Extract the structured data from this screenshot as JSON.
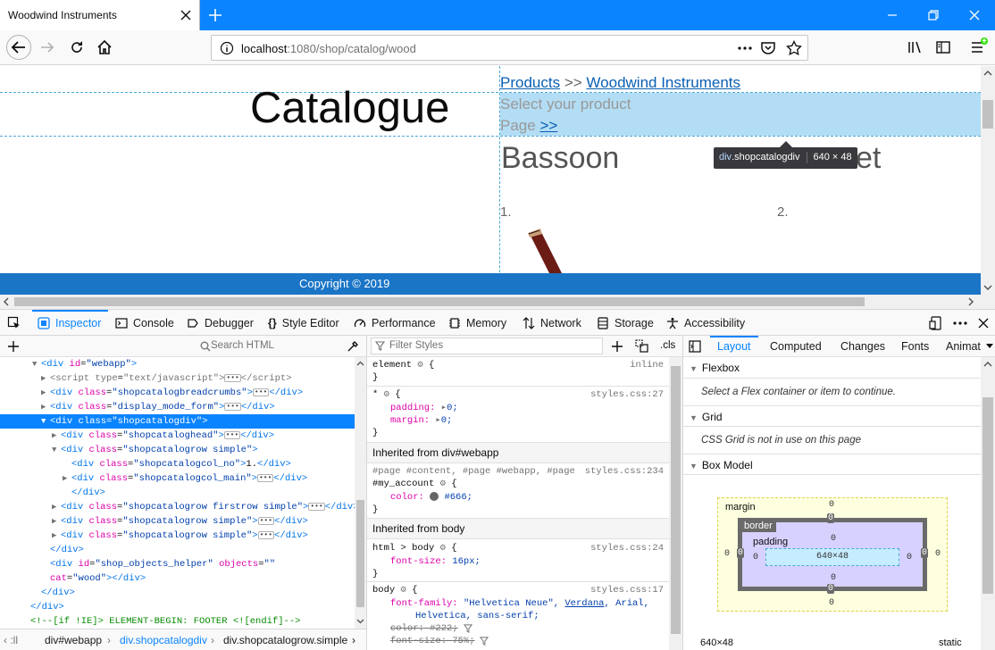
{
  "browser": {
    "tab_title": "Woodwind Instruments",
    "url_host": "localhost",
    "url_rest": ":1080/shop/catalog/wood"
  },
  "page": {
    "heading": "Catalogue",
    "breadcrumb_products": "Products",
    "breadcrumb_sep": ">>",
    "breadcrumb_current": "Woodwind Instruments",
    "select_product": "Select your product",
    "page_label": "Page",
    "page_next": ">>",
    "product_1_name": "Bassoon",
    "product_2_name_partial": "et",
    "item_1_number": "1.",
    "item_2_number": "2.",
    "footer": "Copyright © 2019",
    "tooltip_tag": "div",
    "tooltip_class": ".shopcatalogdiv",
    "tooltip_size": "640 × 48"
  },
  "devtools": {
    "tabs": [
      "Inspector",
      "Console",
      "Debugger",
      "Style Editor",
      "Performance",
      "Memory",
      "Network",
      "Storage",
      "Accessibility"
    ],
    "search_html_placeholder": "Search HTML",
    "filter_styles_placeholder": "Filter Styles",
    "cls_label": ".cls",
    "markup": [
      {
        "indent": 36,
        "twisty": "▼",
        "html": "<span class=\"t\">&lt;div</span> <span class=\"a\">id</span>=<span class=\"v\">\"webapp\"</span><span class=\"t\">&gt;</span>"
      },
      {
        "indent": 46,
        "twisty": "▶",
        "html": "<span class=\"c\">&lt;script</span> <span class=\"c\">type</span>=<span class=\"c\">\"text/javascript\"</span><span class=\"c\">&gt;</span><span class=\"ell\">•••</span><span class=\"c\">&lt;/script&gt;</span>"
      },
      {
        "indent": 46,
        "twisty": "▶",
        "html": "<span class=\"t\">&lt;div</span> <span class=\"a\">class</span>=<span class=\"v\">\"shopcatalogbreadcrumbs\"</span><span class=\"t\">&gt;</span><span class=\"ell\">•••</span><span class=\"t\">&lt;/div&gt;</span>"
      },
      {
        "indent": 46,
        "twisty": "▶",
        "html": "<span class=\"t\">&lt;div</span> <span class=\"a\">class</span>=<span class=\"v\">\"display_mode_form\"</span><span class=\"t\">&gt;</span><span class=\"ell\">•••</span><span class=\"t\">&lt;/div&gt;</span>"
      },
      {
        "indent": 46,
        "twisty": "▼",
        "html": "<span class=\"t\">&lt;div</span> <span class=\"a\">class</span>=<span class=\"v\">\"shopcatalogdiv\"</span><span class=\"t\">&gt;</span>",
        "selected": true
      },
      {
        "indent": 58,
        "twisty": "▶",
        "html": "<span class=\"t\">&lt;div</span> <span class=\"a\">class</span>=<span class=\"v\">\"shopcataloghead\"</span><span class=\"t\">&gt;</span><span class=\"ell\">•••</span><span class=\"t\">&lt;/div&gt;</span>"
      },
      {
        "indent": 58,
        "twisty": "▼",
        "html": "<span class=\"t\">&lt;div</span> <span class=\"a\">class</span>=<span class=\"v\">\"shopcatalogrow simple\"</span><span class=\"t\">&gt;</span>"
      },
      {
        "indent": 70,
        "twisty": "",
        "html": "<span class=\"t\">&lt;div</span> <span class=\"a\">class</span>=<span class=\"v\">\"shopcatalogcol_no\"</span><span class=\"t\">&gt;</span><span class=\"tx\">1.</span><span class=\"t\">&lt;/div&gt;</span>"
      },
      {
        "indent": 70,
        "twisty": "▶",
        "html": "<span class=\"t\">&lt;div</span> <span class=\"a\">class</span>=<span class=\"v\">\"shopcatalogcol_main\"</span><span class=\"t\">&gt;</span><span class=\"ell\">•••</span><span class=\"t\">&lt;/div&gt;</span>"
      },
      {
        "indent": 70,
        "twisty": "",
        "html": "<span class=\"t\">&lt;/div&gt;</span>"
      },
      {
        "indent": 58,
        "twisty": "▶",
        "html": "<span class=\"t\">&lt;div</span> <span class=\"a\">class</span>=<span class=\"v\">\"shopcatalogrow firstrow simple\"</span><span class=\"t\">&gt;</span><span class=\"ell\">•••</span><span class=\"t\">&lt;/div&gt;</span>"
      },
      {
        "indent": 58,
        "twisty": "▶",
        "html": "<span class=\"t\">&lt;div</span> <span class=\"a\">class</span>=<span class=\"v\">\"shopcatalogrow simple\"</span><span class=\"t\">&gt;</span><span class=\"ell\">•••</span><span class=\"t\">&lt;/div&gt;</span>"
      },
      {
        "indent": 58,
        "twisty": "▶",
        "html": "<span class=\"t\">&lt;div</span> <span class=\"a\">class</span>=<span class=\"v\">\"shopcatalogrow simple\"</span><span class=\"t\">&gt;</span><span class=\"ell\">•••</span><span class=\"t\">&lt;/div&gt;</span>"
      },
      {
        "indent": 46,
        "twisty": "",
        "html": "<span class=\"t\">&lt;/div&gt;</span>"
      },
      {
        "indent": 46,
        "twisty": "",
        "html": "<span class=\"t\">&lt;div</span> <span class=\"a\">id</span>=<span class=\"v\">\"shop_objects_helper\"</span> <span class=\"a\">objects</span>=<span class=\"v\">\"\"</span>"
      },
      {
        "indent": 46,
        "twisty": "",
        "html": "<span class=\"a\">cat</span>=<span class=\"v\">\"wood\"</span><span class=\"t\">&gt;&lt;/div&gt;</span>"
      },
      {
        "indent": 36,
        "twisty": "",
        "html": "<span class=\"t\">&lt;/div&gt;</span>"
      },
      {
        "indent": 24,
        "twisty": "",
        "html": "<span class=\"t\">&lt;/div&gt;</span>"
      },
      {
        "indent": 24,
        "twisty": "",
        "html": "<span style=\"color:#058b00\">&lt;!--[if !IE]&gt; ELEMENT-BEGIN: FOOTER &lt;![endif]--&gt;</span>"
      }
    ],
    "breadcrumbs": [
      "div#webapp",
      "div.shopcatalogdiv",
      "div.shopcatalogrow.simple"
    ],
    "rules": {
      "element_selector": "element",
      "element_source": "inline",
      "star_selector": "*",
      "star_source": "styles.css:27",
      "padding_prop": "padding:",
      "padding_val": "0;",
      "margin_prop": "margin:",
      "margin_val": "0;",
      "inherited_webapp": "Inherited from div#webapp",
      "webapp_selector_1": "#page #content, #page #webapp, #page",
      "webapp_selector_2": "#my_account",
      "webapp_source": "styles.css:234",
      "color_prop": "color:",
      "color_val": "#666;",
      "inherited_body": "Inherited from body",
      "html_body_selector": "html > body",
      "html_body_source": "styles.css:24",
      "fontsize_prop": "font-size:",
      "fontsize_val": "16px;",
      "body_selector": "body",
      "body_source": "styles.css:17",
      "fontfamily_prop": "font-family:",
      "fontfamily_val_1": "\"Helvetica Neue\",",
      "fontfamily_val_2": "Verdana",
      "fontfamily_val_3": ", Arial,",
      "fontfamily_val_4": "Helvetica, sans-serif;",
      "color2_prop": "color:",
      "color2_val": "#222;",
      "fontsize2_prop": "font-size:",
      "fontsize2_val": "75%;"
    },
    "layout_tabs": [
      "Layout",
      "Computed",
      "Changes",
      "Fonts",
      "Animat"
    ],
    "flexbox_title": "Flexbox",
    "flexbox_msg": "Select a Flex container or item to continue.",
    "grid_title": "Grid",
    "grid_msg": "CSS Grid is not in use on this page",
    "boxmodel_title": "Box Model",
    "bm": {
      "margin_label": "margin",
      "border_label": "border",
      "padding_label": "padding",
      "content_size": "640×48",
      "zero": "0",
      "footer_size": "640×48",
      "footer_position": "static"
    }
  },
  "colors": {
    "accent": "#0a84ff",
    "footer_bg": "#1b75c7",
    "highlight": "#75c1eb"
  }
}
